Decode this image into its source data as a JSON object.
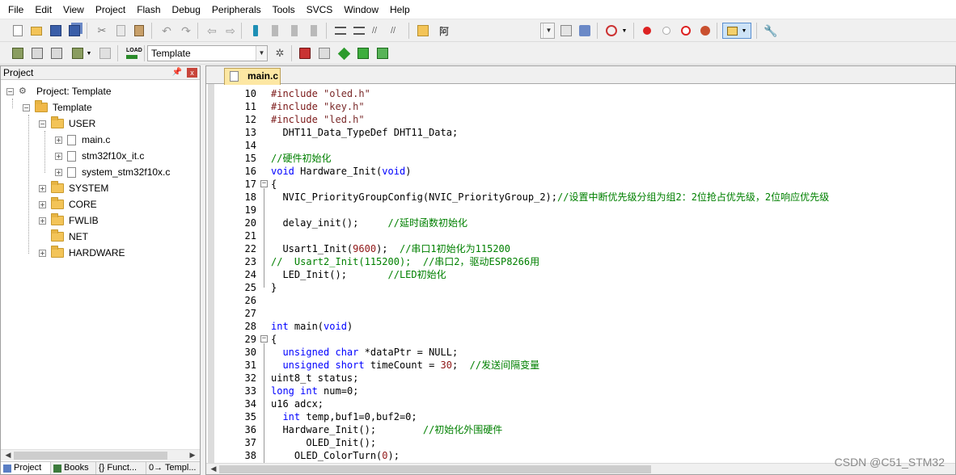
{
  "menu": [
    "File",
    "Edit",
    "View",
    "Project",
    "Flash",
    "Debug",
    "Peripherals",
    "Tools",
    "SVCS",
    "Window",
    "Help"
  ],
  "toolbar": {
    "find_text": "阿",
    "target_combo": "Template"
  },
  "project_panel": {
    "title": "Project",
    "pin_glyph": "ᵖ",
    "close_glyph": "x",
    "tree": {
      "root": "Project: Template",
      "target": "Template",
      "user_group": "USER",
      "user_files": [
        "main.c",
        "stm32f10x_it.c",
        "system_stm32f10x.c"
      ],
      "groups": [
        "SYSTEM",
        "CORE",
        "FWLIB",
        "NET",
        "HARDWARE"
      ]
    },
    "tabs": [
      "Project",
      "Books",
      "{} Funct...",
      "0→ Templ..."
    ]
  },
  "editor": {
    "active_tab": "main.c",
    "lines": [
      {
        "n": "10",
        "code": "#include \"oled.h\""
      },
      {
        "n": "11",
        "code": "#include \"key.h\""
      },
      {
        "n": "12",
        "code": "#include \"led.h\""
      },
      {
        "n": "13",
        "code": "  DHT11_Data_TypeDef DHT11_Data;"
      },
      {
        "n": "14",
        "code": ""
      },
      {
        "n": "15",
        "code": "//硬件初始化"
      },
      {
        "n": "16",
        "code": "void Hardware_Init(void)"
      },
      {
        "n": "17",
        "code": "{"
      },
      {
        "n": "18",
        "code": "  NVIC_PriorityGroupConfig(NVIC_PriorityGroup_2);//设置中断优先级分组为组2：2位抢占优先级，2位响应优先级"
      },
      {
        "n": "19",
        "code": ""
      },
      {
        "n": "20",
        "code": "  delay_init();     //延时函数初始化"
      },
      {
        "n": "21",
        "code": ""
      },
      {
        "n": "22",
        "code": "  Usart1_Init(9600);  //串口1初始化为115200"
      },
      {
        "n": "23",
        "code": "//  Usart2_Init(115200);  //串口2，驱动ESP8266用"
      },
      {
        "n": "24",
        "code": "  LED_Init();       //LED初始化"
      },
      {
        "n": "25",
        "code": "}"
      },
      {
        "n": "26",
        "code": ""
      },
      {
        "n": "27",
        "code": ""
      },
      {
        "n": "28",
        "code": "int main(void)"
      },
      {
        "n": "29",
        "code": "{"
      },
      {
        "n": "30",
        "code": "  unsigned char *dataPtr = NULL;"
      },
      {
        "n": "31",
        "code": "  unsigned short timeCount = 30;  //发送间隔变量"
      },
      {
        "n": "32",
        "code": "uint8_t status;"
      },
      {
        "n": "33",
        "code": "long int num=0;"
      },
      {
        "n": "34",
        "code": "u16 adcx;"
      },
      {
        "n": "35",
        "code": "  int temp,buf1=0,buf2=0;"
      },
      {
        "n": "36",
        "code": "  Hardware_Init();        //初始化外围硬件"
      },
      {
        "n": "37",
        "code": "      OLED_Init();"
      },
      {
        "n": "38",
        "code": "    OLED_ColorTurn(0);"
      }
    ]
  },
  "watermark": "CSDN @C51_STM32"
}
